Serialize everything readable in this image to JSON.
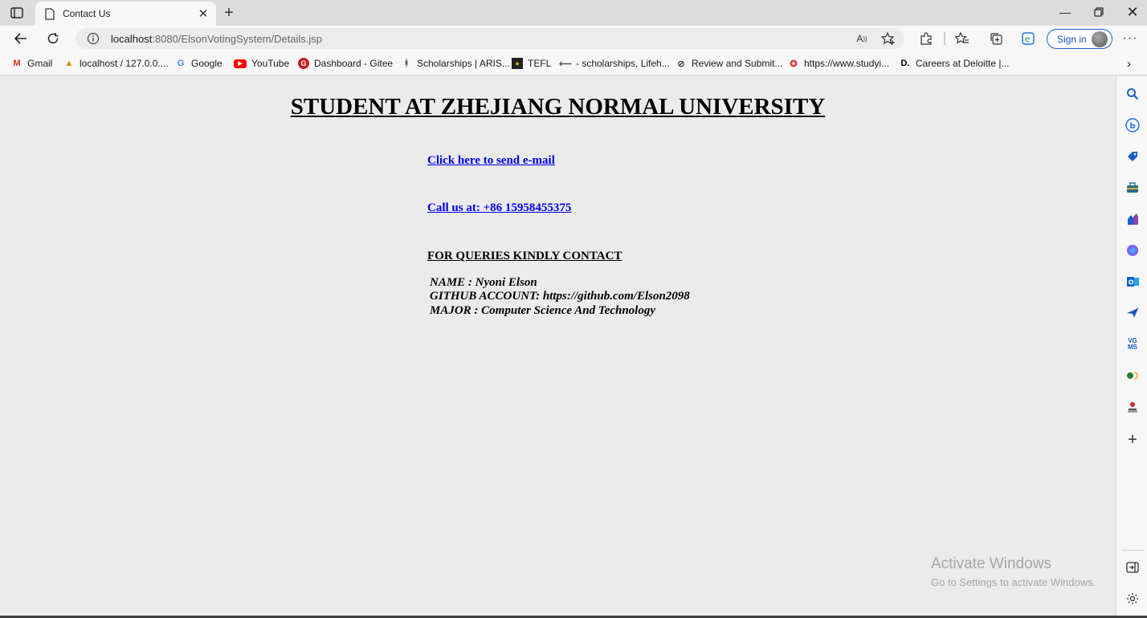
{
  "browser": {
    "tab_title": "Contact Us",
    "url_host": "localhost",
    "url_rest": ":8080/ElsonVotingSystem/Details.jsp",
    "signin_label": "Sign in",
    "accent": "#2560c9"
  },
  "bookmarks": [
    {
      "label": "Gmail",
      "icon": "gmail-icon",
      "color": "#d93025"
    },
    {
      "label": "localhost / 127.0.0....",
      "icon": "phpmyadmin-icon",
      "color": "#e08a00"
    },
    {
      "label": "Google",
      "icon": "google-icon",
      "color": "#4285f4"
    },
    {
      "label": "YouTube",
      "icon": "youtube-icon",
      "color": "#ff0000"
    },
    {
      "label": "Dashboard - Gitee",
      "icon": "gitee-icon",
      "color": "#c71d23"
    },
    {
      "label": "Scholarships | ARIS...",
      "icon": "aris-icon",
      "color": "#333333"
    },
    {
      "label": "TEFL",
      "icon": "tefl-icon",
      "color": "#e0a800"
    },
    {
      "label": "- scholarships, Lifeh...",
      "icon": "lifehack-icon",
      "color": "#555555"
    },
    {
      "label": "Review and Submit...",
      "icon": "review-icon",
      "color": "#444444"
    },
    {
      "label": "https://www.studyi...",
      "icon": "studyin-icon",
      "color": "#d32f2f"
    },
    {
      "label": "Careers at Deloitte |...",
      "icon": "deloitte-icon",
      "color": "#000000"
    }
  ],
  "page": {
    "heading": "STUDENT AT ZHEJIANG NORMAL UNIVERSITY",
    "email_link": "Click here to send e-mail",
    "phone_link": "Call us at: +86 15958455375",
    "queries_heading": "FOR QUERIES KINDLY CONTACT",
    "name_line": "NAME : Nyoni Elson",
    "github_line": "GITHUB ACCOUNT: https://github.com/Elson2098",
    "major_line": "MAJOR : Computer Science And Technology"
  },
  "watermark": {
    "title": "Activate Windows",
    "subtitle": "Go to Settings to activate Windows."
  }
}
